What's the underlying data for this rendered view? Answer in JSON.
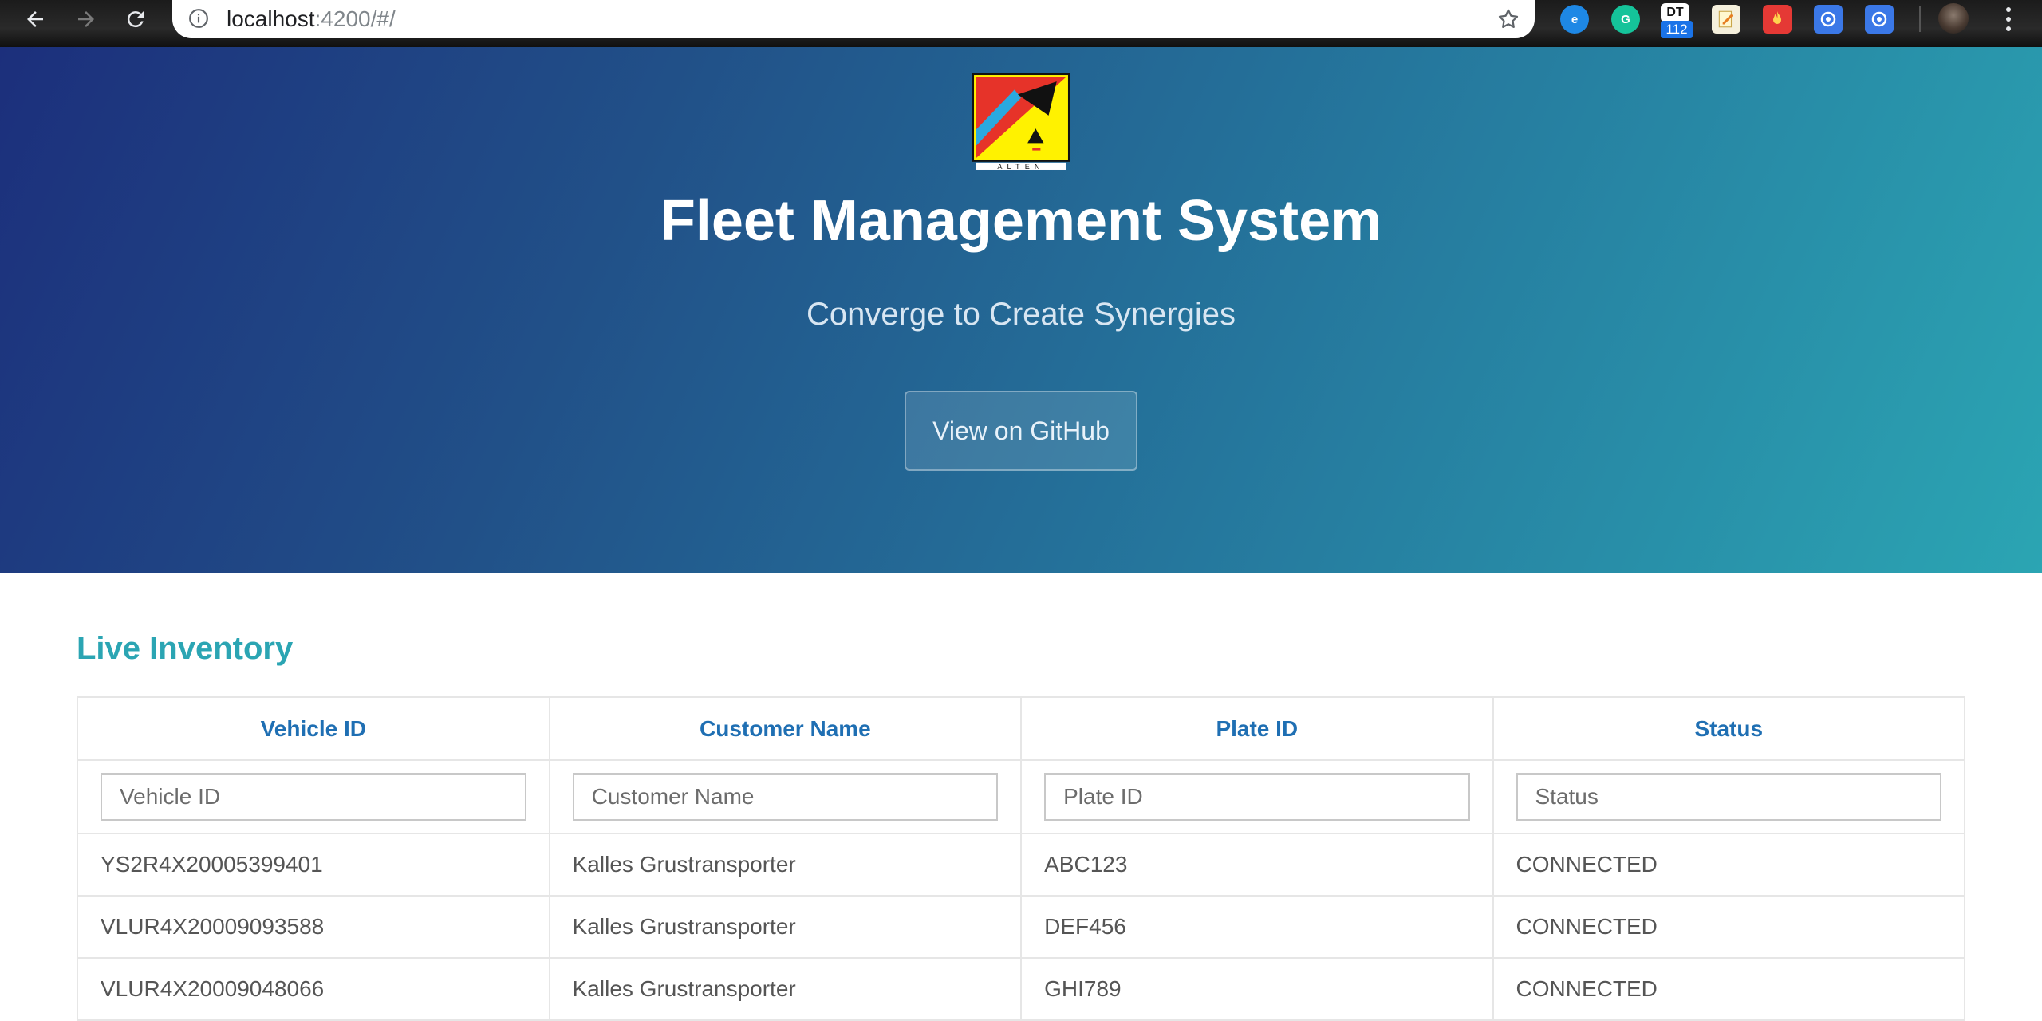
{
  "browser": {
    "url_host": "localhost",
    "url_rest": ":4200/#/",
    "extension_badge": "112",
    "extension_label": "DT",
    "icons": [
      "back-icon",
      "forward-icon",
      "reload-icon",
      "info-icon",
      "star-icon",
      "edge-icon",
      "grammarly-icon",
      "dt-icon",
      "notes-icon",
      "fire-icon",
      "shield-icon",
      "shield-icon",
      "avatar",
      "kebab-menu-icon"
    ]
  },
  "hero": {
    "title": "Fleet Management System",
    "tagline": "Converge to Create Synergies",
    "github_button": "View on GitHub",
    "logo_text": "ALTEN"
  },
  "inventory": {
    "title": "Live Inventory",
    "columns": [
      "Vehicle ID",
      "Customer Name",
      "Plate ID",
      "Status"
    ],
    "filters": [
      "Vehicle ID",
      "Customer Name",
      "Plate ID",
      "Status"
    ],
    "rows": [
      [
        "YS2R4X20005399401",
        "Kalles Grustransporter",
        "ABC123",
        "CONNECTED"
      ],
      [
        "VLUR4X20009093588",
        "Kalles Grustransporter",
        "DEF456",
        "CONNECTED"
      ],
      [
        "VLUR4X20009048066",
        "Kalles Grustransporter",
        "GHI789",
        "CONNECTED"
      ]
    ]
  },
  "colors": {
    "hero_start": "#1c2f7c",
    "hero_end": "#2ba5b3",
    "section_title": "#2ba5b3",
    "table_header": "#1f6fb3"
  }
}
